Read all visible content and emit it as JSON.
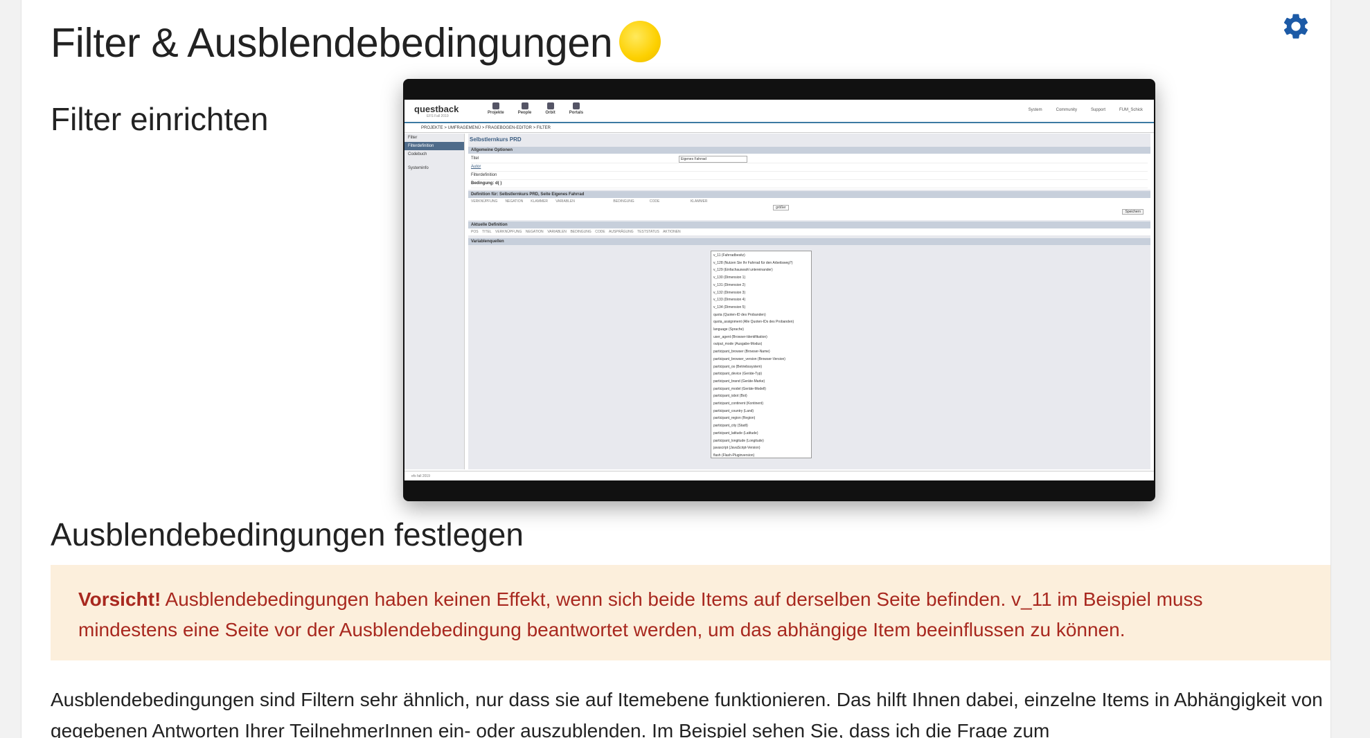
{
  "page": {
    "title": "Filter & Ausblendebedingungen",
    "section1": "Filter einrichten",
    "section2": "Ausblendebedingungen festlegen",
    "warning_bold": "Vorsicht!",
    "warning_text": " Ausblendebedingungen haben keinen Effekt, wenn sich beide Items auf derselben Seite befinden. v_11 im Beispiel muss mindestens eine Seite vor der Ausblendebedingung beantwortet werden, um das abhängige Item beeinflussen zu können.",
    "body": "Ausblendebedingungen sind Filtern sehr ähnlich, nur dass sie auf Itemebene funktionieren. Das hilft Ihnen dabei, einzelne Items in Abhängigkeit von gegebenen Antworten Ihrer TeilnehmerInnen ein- oder auszublenden. Im Beispiel sehen Sie, dass ich die Frage zum",
    "accent_color": "#1c5aa6",
    "warning_color": "#a8281f",
    "warning_bg": "#fcefdc"
  },
  "screenshot": {
    "brand": "questback",
    "brand_sub": "EFS Fall 2019",
    "nav": [
      "Projekte",
      "People",
      "Orbit",
      "Portals"
    ],
    "right_nav": [
      "System",
      "Community",
      "Support",
      "FUM_Schick"
    ],
    "breadcrumb": "PROJEKTE  >  UMFRAGEMENÜ  >  FRAGEBOGEN-EDITOR  >  FILTER",
    "side": [
      "Filter",
      "Filterdefinition",
      "Codebuch",
      "Systeminfo"
    ],
    "main_title": "Selbstlernkurs PRD",
    "section_general": "Allgemeine Optionen",
    "field_title": "Titel",
    "field_title_value": "Eigenes Fahrrad",
    "field_author": "Autor",
    "field_def": "Filterdefinition",
    "field_cond": "Bedingung: d( )",
    "def_header": "Definition für: Selbstlernkurs PRD, Seite Eigenes Fahrrad",
    "def_cols": "VERKNÜPFUNG        NEGATION        KLAMMER        VARIABLEN                                        BEDINGUNG                CODE                                KLAMMER",
    "current_def": "Aktuelle Definition",
    "current_cols": "POS    TITEL    VERKNÜPFUNG    NEGATION    VARIABLEN    BEDINGUNG    CODE    AUSPRÄGUNG    TESTSTATUS    AKTIONEN",
    "varsources": "Variablenquellen",
    "cond_value": "größer",
    "save_label": "Speichern",
    "dropdown_items": [
      "v_11 (Fahrradbesitz)",
      "v_128 (Nutzen Sie Ihr Fahrrad für den Arbeitsweg?)",
      "v_129 (Einfachauswahl untereinander)",
      "v_130 (Dimension 1)",
      "v_131 (Dimension 2)",
      "v_132 (Dimension 3)",
      "v_133 (Dimension 4)",
      "v_134 (Dimension 5)",
      "quota (Quoten-ID des Probanden)",
      "quota_assignment (Alle Quoten-IDs des Probanden)",
      "language (Sprache)",
      "user_agent (Browser-Identifikation)",
      "output_mode (Ausgabe-Modus)",
      "participant_browser (Browser-Name)",
      "participant_browser_version (Browser-Version)",
      "participant_os (Betriebssystem)",
      "participant_device (Geräte-Typ)",
      "participant_brand (Geräte-Marke)",
      "participant_model (Geräte-Modell)",
      "participant_isbot (Bot)",
      "participant_continent (Kontinent)",
      "participant_country (Land)",
      "participant_region (Region)",
      "participant_city (Stadt)",
      "participant_latitude (Latitude)",
      "participant_longitude (Longitude)",
      "javascript (JavaScript-Version)",
      "flash (Flash-Pluginversion)"
    ],
    "footer": "efs fall 2019"
  }
}
